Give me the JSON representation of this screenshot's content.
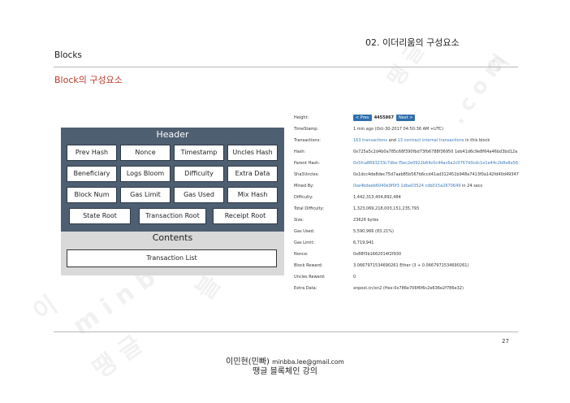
{
  "chapter_title": "02. 이더리움의 구성요소",
  "section_label": "Blocks",
  "slide_title": "Block의 구성요소",
  "diagram": {
    "header_title": "Header",
    "header_fields": [
      "Prev Hash",
      "Nonce",
      "Timestamp",
      "Uncles Hash",
      "Beneficiary",
      "Logs Bloom",
      "Difficulty",
      "Extra Data",
      "Block Num",
      "Gas Limit",
      "Gas Used",
      "Mix Hash"
    ],
    "root_fields": [
      "State Root",
      "Transaction Root",
      "Receipt Root"
    ],
    "contents_title": "Contents",
    "contents_item": "Transaction List"
  },
  "block_details": {
    "prev_label": "< Prev",
    "next_label": "Next >",
    "height_value": "4455867",
    "rows": [
      {
        "label": "Height:",
        "value": ""
      },
      {
        "label": "TimeStamp:",
        "value": "1 min ago (Oct-30-2017 04:50:36 AM +UTC)"
      },
      {
        "label": "Transactions:",
        "value_link1": "163 transactions",
        "value_mid": " and ",
        "value_link2": "13 contract internal transactions",
        "value_tail": " in this block"
      },
      {
        "label": "Hash:",
        "value": "0x725a5c2d4b0a785c68f390fbd73fb6788f36950 1eb41d6c9e8f64a46bd3bd12a"
      },
      {
        "label": "Parent Hash:",
        "value_link": "0x5fca8693233c7dbe f5ec2e0922b64c0c44ac6a2c0767d0cdc1e1e44c2b8e8a56"
      },
      {
        "label": "Sha3Uncles:",
        "value": "0x1dcc4de8dec75d7aab85b567b6ccd41ad312451b948a7413f0a142fd40d49347"
      },
      {
        "label": "Mined By:",
        "value_link": "0xe4bdeeb6040e9f0f3 1dba03524 cdb015a2670649",
        "value_tail": " in 24 secs"
      },
      {
        "label": "Difficulty:",
        "value": "1,442,313,404,892,484"
      },
      {
        "label": "Total Difficulty:",
        "value": "1,323,069,218,003,151,235,793"
      },
      {
        "label": "Size:",
        "value": "23626 bytes"
      },
      {
        "label": "Gas Used:",
        "value": "5,590,966 (83.21%)"
      },
      {
        "label": "Gas Limit:",
        "value": "6,719,941"
      },
      {
        "label": "Nonce:",
        "value": "0x88f3b1662014f2f930"
      },
      {
        "label": "Block Reward:",
        "value": "3.0667971534690261 Ether (3 + 0.0667971534690261)"
      },
      {
        "label": "Uncles Reward:",
        "value": "0"
      },
      {
        "label": "Extra Data:",
        "value": "xnpool.cn/xn2 (Hex:0x786e706f6f6c2e636e2f786e32)"
      }
    ]
  },
  "page_number": "27",
  "footer": {
    "author": "이민현(민빠)",
    "email": "minbba.lee@gmail.com",
    "course": "땡글 블록체인 강의"
  },
  "colors": {
    "title_red": "#c0392b",
    "header_band": "#4f5f72",
    "contents_band": "#d9d9d9",
    "link_blue": "#3a7ab8",
    "nav_button": "#2f6fad"
  }
}
